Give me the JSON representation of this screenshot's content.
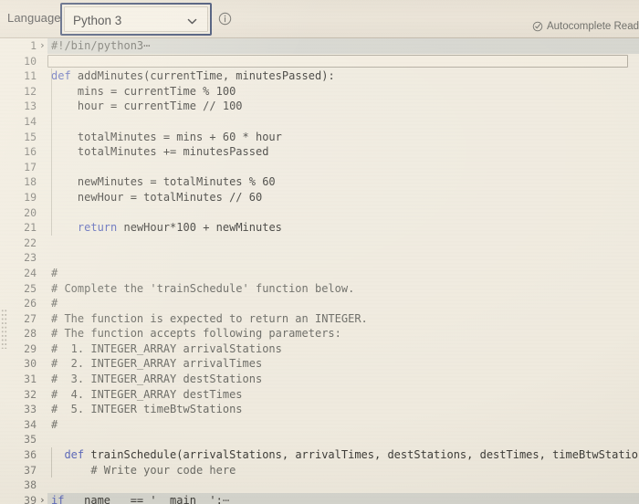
{
  "toolbar": {
    "language_label": "Language",
    "language_value": "Python 3",
    "language_caret_icon": "chevron-down-icon",
    "info_icon": "info-circle-icon",
    "autocomplete_icon": "check-circle-icon",
    "autocomplete_status": "Autocomplete Read"
  },
  "editor": {
    "language_mode": "python",
    "colors": {
      "background": "#efeade",
      "keyword": "#5663b8",
      "comment": "#6a6a64",
      "text": "#3c3b37",
      "gutter": "#74736e",
      "folded_band": "#d6d6cf",
      "focus_ring": "#39486e"
    },
    "lines": [
      {
        "num": "1",
        "fold": "›",
        "folded": true,
        "tokens": [
          {
            "t": "cm",
            "v": "#!/bin/python3"
          },
          {
            "t": "dots",
            "v": "⋯"
          }
        ]
      },
      {
        "num": "10",
        "fold": "",
        "inline_box": true,
        "tokens": []
      },
      {
        "num": "11",
        "fold": "",
        "tokens": [
          {
            "t": "kw",
            "v": "def"
          },
          {
            "t": "op",
            "v": " addMinutes(currentTime, minutesPassed):"
          }
        ]
      },
      {
        "num": "12",
        "fold": "",
        "tokens": [
          {
            "t": "op",
            "v": "    mins = currentTime % "
          },
          {
            "t": "num",
            "v": "100"
          }
        ]
      },
      {
        "num": "13",
        "fold": "",
        "tokens": [
          {
            "t": "op",
            "v": "    hour = currentTime // "
          },
          {
            "t": "num",
            "v": "100"
          }
        ]
      },
      {
        "num": "14",
        "fold": "",
        "tokens": []
      },
      {
        "num": "15",
        "fold": "",
        "tokens": [
          {
            "t": "op",
            "v": "    totalMinutes = mins + "
          },
          {
            "t": "num",
            "v": "60"
          },
          {
            "t": "op",
            "v": " * hour"
          }
        ]
      },
      {
        "num": "16",
        "fold": "",
        "tokens": [
          {
            "t": "op",
            "v": "    totalMinutes += minutesPassed"
          }
        ]
      },
      {
        "num": "17",
        "fold": "",
        "tokens": []
      },
      {
        "num": "18",
        "fold": "",
        "tokens": [
          {
            "t": "op",
            "v": "    newMinutes = totalMinutes % "
          },
          {
            "t": "num",
            "v": "60"
          }
        ]
      },
      {
        "num": "19",
        "fold": "",
        "tokens": [
          {
            "t": "op",
            "v": "    newHour = totalMinutes // "
          },
          {
            "t": "num",
            "v": "60"
          }
        ]
      },
      {
        "num": "20",
        "fold": "",
        "tokens": []
      },
      {
        "num": "21",
        "fold": "",
        "tokens": [
          {
            "t": "kw",
            "v": "    return"
          },
          {
            "t": "op",
            "v": " newHour*"
          },
          {
            "t": "num",
            "v": "100"
          },
          {
            "t": "op",
            "v": " + newMinutes"
          }
        ]
      },
      {
        "num": "22",
        "fold": "",
        "tokens": []
      },
      {
        "num": "23",
        "fold": "",
        "tokens": []
      },
      {
        "num": "24",
        "fold": "",
        "tokens": [
          {
            "t": "cm",
            "v": "#"
          }
        ]
      },
      {
        "num": "25",
        "fold": "",
        "tokens": [
          {
            "t": "cm",
            "v": "# Complete the 'trainSchedule' function below."
          }
        ]
      },
      {
        "num": "26",
        "fold": "",
        "tokens": [
          {
            "t": "cm",
            "v": "#"
          }
        ]
      },
      {
        "num": "27",
        "fold": "",
        "tokens": [
          {
            "t": "cm",
            "v": "# The function is expected to return an INTEGER."
          }
        ]
      },
      {
        "num": "28",
        "fold": "",
        "tokens": [
          {
            "t": "cm",
            "v": "# The function accepts following parameters:"
          }
        ]
      },
      {
        "num": "29",
        "fold": "",
        "tokens": [
          {
            "t": "cm",
            "v": "#  1. INTEGER_ARRAY arrivalStations"
          }
        ]
      },
      {
        "num": "30",
        "fold": "",
        "tokens": [
          {
            "t": "cm",
            "v": "#  2. INTEGER_ARRAY arrivalTimes"
          }
        ]
      },
      {
        "num": "31",
        "fold": "",
        "tokens": [
          {
            "t": "cm",
            "v": "#  3. INTEGER_ARRAY destStations"
          }
        ]
      },
      {
        "num": "32",
        "fold": "",
        "tokens": [
          {
            "t": "cm",
            "v": "#  4. INTEGER_ARRAY destTimes"
          }
        ]
      },
      {
        "num": "33",
        "fold": "",
        "tokens": [
          {
            "t": "cm",
            "v": "#  5. INTEGER timeBtwStations"
          }
        ]
      },
      {
        "num": "34",
        "fold": "",
        "tokens": [
          {
            "t": "cm",
            "v": "#"
          }
        ]
      },
      {
        "num": "35",
        "fold": "",
        "tokens": []
      },
      {
        "num": "36",
        "fold": "",
        "tokens": [
          {
            "t": "kw",
            "v": "  def"
          },
          {
            "t": "op",
            "v": " trainSchedule(arrivalStations, arrivalTimes, destStations, destTimes, timeBtwStations):"
          }
        ]
      },
      {
        "num": "37",
        "fold": "",
        "tokens": [
          {
            "t": "cm",
            "v": "      # Write your code here"
          }
        ]
      },
      {
        "num": "38",
        "fold": "",
        "tokens": []
      },
      {
        "num": "39",
        "fold": "›",
        "folded": true,
        "tokens": [
          {
            "t": "kw",
            "v": "if"
          },
          {
            "t": "op",
            "v": " __name__ == "
          },
          {
            "t": "str",
            "v": "'__main__'"
          },
          {
            "t": "op",
            "v": ":"
          },
          {
            "t": "dots",
            "v": "⋯"
          }
        ]
      }
    ]
  }
}
